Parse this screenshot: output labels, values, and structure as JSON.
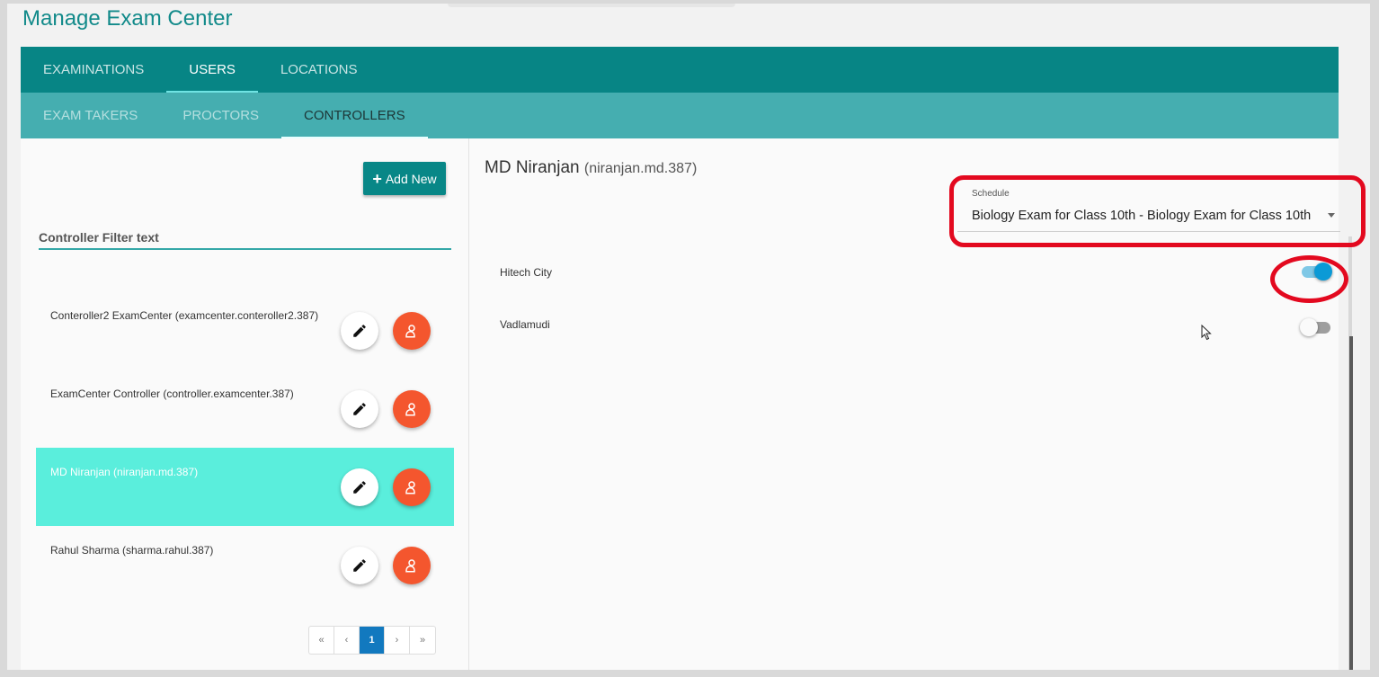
{
  "page": {
    "title": "Manage Exam Center"
  },
  "main_tabs": [
    {
      "label": "EXAMINATIONS",
      "active": false
    },
    {
      "label": "USERS",
      "active": true
    },
    {
      "label": "LOCATIONS",
      "active": false
    }
  ],
  "sub_tabs": [
    {
      "label": "EXAM TAKERS",
      "active": false
    },
    {
      "label": "PROCTORS",
      "active": false
    },
    {
      "label": "CONTROLLERS",
      "active": true
    }
  ],
  "left": {
    "add_label": "Add New",
    "filter_placeholder": "Controller Filter text",
    "controllers": [
      {
        "name": "Conteroller2 ExamCenter (examcenter.conteroller2.387)",
        "selected": false
      },
      {
        "name": "ExamCenter Controller (controller.examcenter.387)",
        "selected": false
      },
      {
        "name": "MD Niranjan (niranjan.md.387)",
        "selected": true
      },
      {
        "name": "Rahul Sharma (sharma.rahul.387)",
        "selected": false
      }
    ],
    "pagination": {
      "first": "«",
      "prev": "‹",
      "current": "1",
      "next": "›",
      "last": "»"
    }
  },
  "detail": {
    "name": "MD Niranjan",
    "username": "(niranjan.md.387)",
    "schedule": {
      "label": "Schedule",
      "value": "Biology Exam for Class 10th - Biology Exam for Class 10th"
    },
    "locations": [
      {
        "name": "Hitech City",
        "enabled": true
      },
      {
        "name": "Vadlamudi",
        "enabled": false
      }
    ]
  },
  "colors": {
    "primary": "#078585",
    "secondary": "#45aeb0",
    "selected_row": "#5aeedc",
    "accent_orange": "#f4562e",
    "toggle_on": "#0b9ad6",
    "highlight": "#e3091f"
  },
  "icons": {
    "edit": "pencil-icon",
    "user": "person-icon",
    "add": "plus-icon"
  }
}
